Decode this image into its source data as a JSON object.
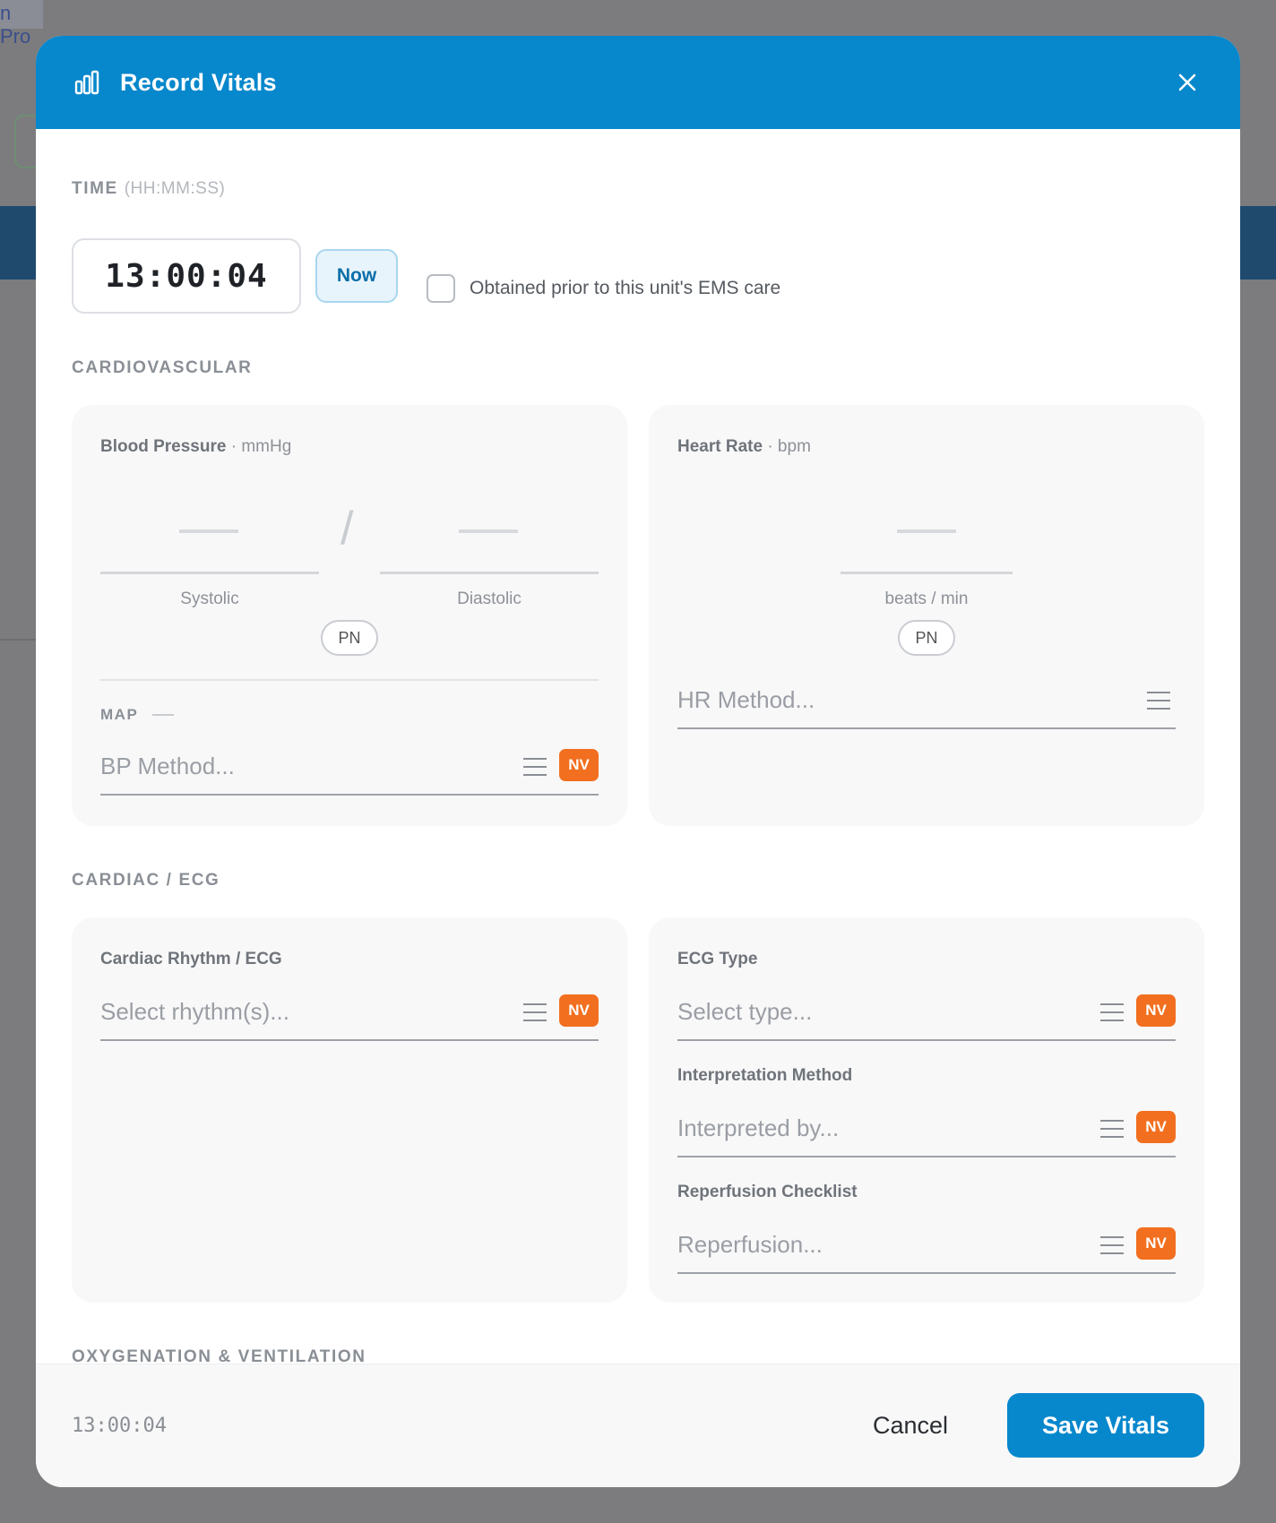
{
  "background": {
    "crumb_text": "n Pro"
  },
  "header": {
    "title": "Record Vitals",
    "icon": "bar-chart-icon",
    "close_icon": "close-icon",
    "accent": "#0787cc"
  },
  "time": {
    "label": "TIME",
    "format_hint": "(HH:MM:SS)",
    "value": "13:00:04",
    "now_label": "Now",
    "prior_checkbox_label": "Obtained prior to this unit's EMS care"
  },
  "sections": {
    "cardiovascular": "CARDIOVASCULAR",
    "cardiac_ecg": "CARDIAC / ECG",
    "oxygenation": "OXYGENATION & VENTILATION"
  },
  "blood_pressure": {
    "title": "Blood Pressure",
    "unit": "· mmHg",
    "separator": "/",
    "systolic_label": "Systolic",
    "diastolic_label": "Diastolic",
    "pn_label": "PN",
    "map_label": "MAP",
    "method_placeholder": "BP Method...",
    "nv_label": "NV"
  },
  "heart_rate": {
    "title": "Heart Rate",
    "unit": "· bpm",
    "sub_label": "beats / min",
    "pn_label": "PN",
    "method_placeholder": "HR Method..."
  },
  "cardiac_rhythm": {
    "title": "Cardiac Rhythm / ECG",
    "placeholder": "Select rhythm(s)...",
    "nv_label": "NV"
  },
  "ecg_type": {
    "title": "ECG Type",
    "placeholder": "Select type...",
    "nv_label": "NV"
  },
  "interpretation": {
    "title": "Interpretation Method",
    "placeholder": "Interpreted by...",
    "nv_label": "NV"
  },
  "reperfusion": {
    "title": "Reperfusion Checklist",
    "placeholder": "Reperfusion...",
    "nv_label": "NV"
  },
  "footer": {
    "time": "13:00:04",
    "cancel_label": "Cancel",
    "save_label": "Save Vitals"
  }
}
